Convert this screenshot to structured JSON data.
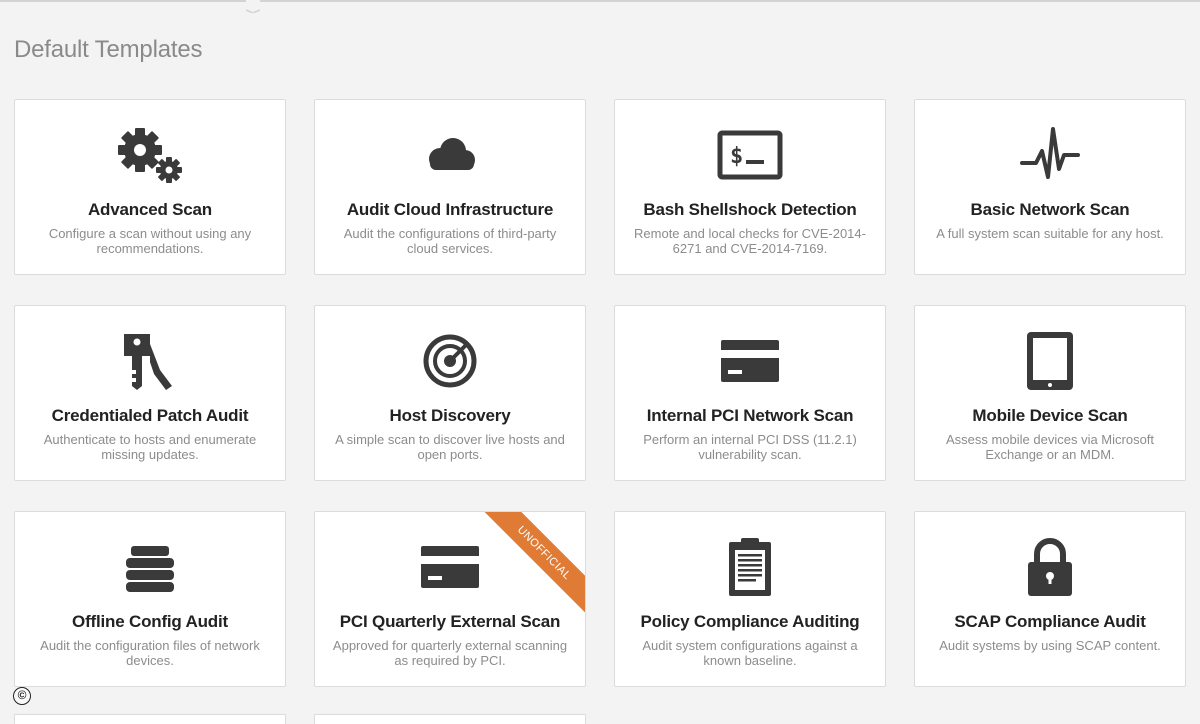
{
  "section_title": "Default Templates",
  "colors": {
    "icon": "#3a3a3a",
    "ribbon": "#e07b36",
    "title": "#222222",
    "desc": "#8c8c8c"
  },
  "cards": [
    {
      "title": "Advanced Scan",
      "description": "Configure a scan without using any recommendations.",
      "icon": "gears-icon"
    },
    {
      "title": "Audit Cloud Infrastructure",
      "description": "Audit the configurations of third-party cloud services.",
      "icon": "cloud-icon"
    },
    {
      "title": "Bash Shellshock Detection",
      "description": "Remote and local checks for CVE-2014-6271 and CVE-2014-7169.",
      "icon": "terminal-icon"
    },
    {
      "title": "Basic Network Scan",
      "description": "A full system scan suitable for any host.",
      "icon": "pulse-icon"
    },
    {
      "title": "Credentialed Patch Audit",
      "description": "Authenticate to hosts and enumerate missing updates.",
      "icon": "keys-icon"
    },
    {
      "title": "Host Discovery",
      "description": "A simple scan to discover live hosts and open ports.",
      "icon": "radar-icon"
    },
    {
      "title": "Internal PCI Network Scan",
      "description": "Perform an internal PCI DSS (11.2.1) vulnerability scan.",
      "icon": "credit-card-icon"
    },
    {
      "title": "Mobile Device Scan",
      "description": "Assess mobile devices via Microsoft Exchange or an MDM.",
      "icon": "tablet-icon"
    },
    {
      "title": "Offline Config Audit",
      "description": "Audit the configuration files of network devices.",
      "icon": "server-stack-icon"
    },
    {
      "title": "PCI Quarterly External Scan",
      "description": "Approved for quarterly external scanning as required by PCI.",
      "icon": "credit-card-icon",
      "ribbon": "UNOFFICIAL"
    },
    {
      "title": "Policy Compliance Auditing",
      "description": "Audit system configurations against a known baseline.",
      "icon": "clipboard-icon"
    },
    {
      "title": "SCAP Compliance Audit",
      "description": "Audit systems by using SCAP content.",
      "icon": "padlock-icon"
    }
  ],
  "copyright_symbol": "©"
}
